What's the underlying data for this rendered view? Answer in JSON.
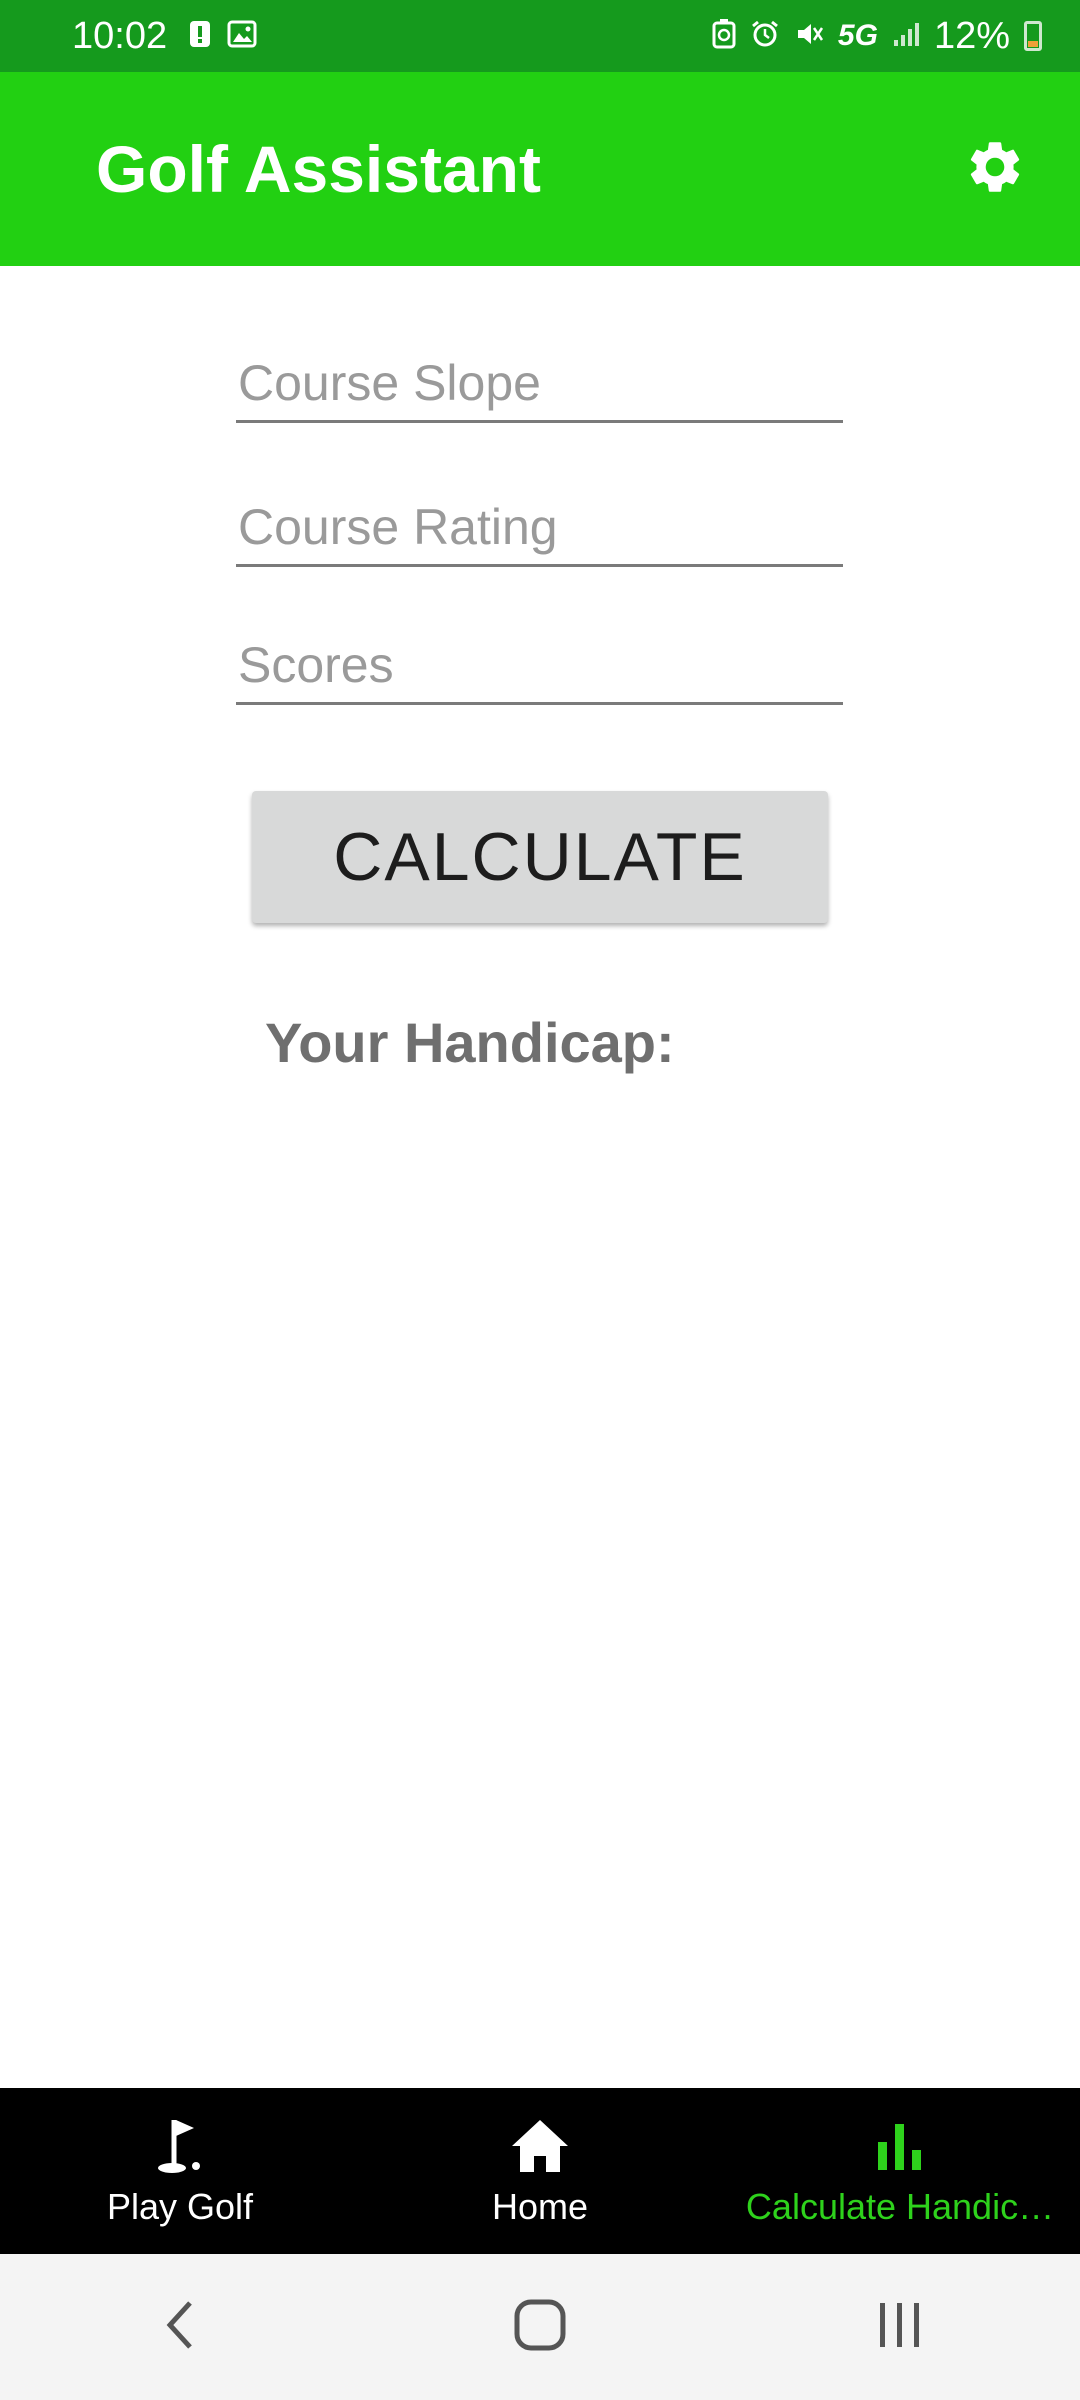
{
  "status_bar": {
    "time": "10:02",
    "network": "5G",
    "battery": "12%"
  },
  "app_bar": {
    "title": "Golf Assistant",
    "settings_icon": "gear-icon"
  },
  "form": {
    "course_slope": {
      "placeholder": "Course Slope",
      "value": ""
    },
    "course_rating": {
      "placeholder": "Course Rating",
      "value": ""
    },
    "scores": {
      "placeholder": "Scores",
      "value": ""
    },
    "calculate_label": "CALCULATE",
    "handicap_label": "Your Handicap:"
  },
  "bottom_nav": {
    "items": [
      {
        "label": "Play Golf",
        "icon": "golf-flag-icon",
        "active": false
      },
      {
        "label": "Home",
        "icon": "home-icon",
        "active": false
      },
      {
        "label": "Calculate Handic…",
        "icon": "bar-chart-icon",
        "active": true
      }
    ]
  },
  "colors": {
    "status_bar": "#159a1d",
    "app_bar": "#22d012",
    "active_nav": "#2ed21c"
  }
}
